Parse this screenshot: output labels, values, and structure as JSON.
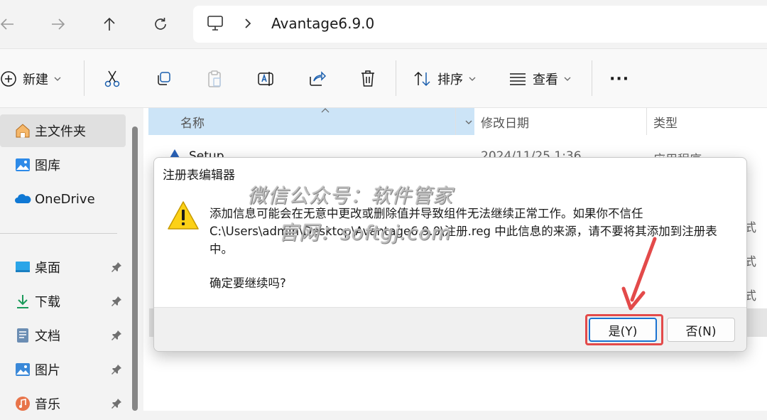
{
  "nav": {
    "address_path": "Avantage6.9.0"
  },
  "commandbar": {
    "new_label": "新建",
    "sort_label": "排序",
    "view_label": "查看",
    "more_label": "···"
  },
  "sidebar": {
    "items": [
      {
        "label": "主文件夹",
        "icon": "home-icon"
      },
      {
        "label": "图库",
        "icon": "gallery-icon"
      },
      {
        "label": "OneDrive",
        "icon": "onedrive-icon"
      },
      {
        "label": "桌面",
        "icon": "desktop-icon"
      },
      {
        "label": "下载",
        "icon": "download-icon"
      },
      {
        "label": "文档",
        "icon": "document-icon"
      },
      {
        "label": "图片",
        "icon": "pictures-icon"
      },
      {
        "label": "音乐",
        "icon": "music-icon"
      }
    ]
  },
  "filelist": {
    "columns": {
      "name": "名称",
      "modified": "修改日期",
      "type": "类型"
    },
    "partial_row": {
      "name": "Setup",
      "modified": "2024/11/25 1:36",
      "type": "应用程序"
    },
    "type_fragments": [
      "式",
      "式",
      "式"
    ]
  },
  "dialog": {
    "title": "注册表编辑器",
    "message": "添加信息可能会在无意中更改或删除值并导致组件无法继续正常工作。如果你不信任 C:\\Users\\admin\\Desktop\\Avantage6.9.0\\注册.reg 中此信息的来源，请不要将其添加到注册表中。",
    "confirm": "确定要继续吗?",
    "yes_label": "是(Y)",
    "no_label": "否(N)"
  },
  "watermark": {
    "line1": "微信公众号：软件管家",
    "line2": "官网：softgj.com"
  },
  "colors": {
    "accent": "#1a73d1",
    "highlight_box": "#e34a4a",
    "header_selected": "#cce4f7"
  }
}
